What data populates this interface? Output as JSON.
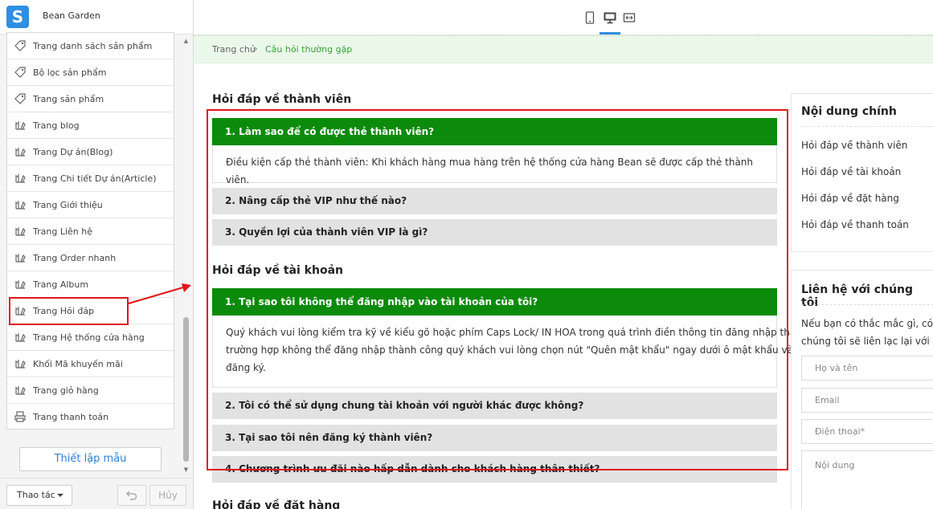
{
  "store": {
    "logo_letter": "S",
    "name": "Bean Garden"
  },
  "sidebar": {
    "items": [
      {
        "label": "Trang danh sách sản phẩm",
        "icon": "tag-icon"
      },
      {
        "label": "Bộ lọc sản phẩm",
        "icon": "tag-icon"
      },
      {
        "label": "Trang sản phẩm",
        "icon": "tag-icon"
      },
      {
        "label": "Trang blog",
        "icon": "blog-icon"
      },
      {
        "label": "Trang Dự án(Blog)",
        "icon": "blog-icon"
      },
      {
        "label": "Trang Chi tiết Dự án(Article)",
        "icon": "blog-icon"
      },
      {
        "label": "Trang Giới thiệu",
        "icon": "blog-icon"
      },
      {
        "label": "Trang Liên hệ",
        "icon": "blog-icon"
      },
      {
        "label": "Trang Order nhanh",
        "icon": "blog-icon"
      },
      {
        "label": "Trang Album",
        "icon": "blog-icon"
      },
      {
        "label": "Trang Hỏi đáp",
        "icon": "blog-icon"
      },
      {
        "label": "Trang Hệ thống cửa hàng",
        "icon": "blog-icon"
      },
      {
        "label": "Khối Mã khuyến mãi",
        "icon": "blog-icon"
      },
      {
        "label": "Trang giỏ hàng",
        "icon": "blog-icon"
      },
      {
        "label": "Trang thanh toán",
        "icon": "printer-icon"
      }
    ],
    "setup_button": "Thiết lập mẫu",
    "action_button": "Thao tác",
    "cancel_button": "Hủy"
  },
  "preview": {
    "breadcrumb": {
      "home": "Trang chủ",
      "separator": "›",
      "current": "Câu hỏi thường gặp"
    },
    "sections": {
      "member": {
        "title": "Hỏi đáp về thành viên",
        "q1": "1. Làm sao để có được thẻ thành viên?",
        "a1": "Điều kiện cấp thẻ thành viên: Khi khách hàng mua hàng trên hệ thống cửa hàng Bean sẽ được cấp thẻ thành viên.",
        "q2": "2. Nâng cấp thẻ VIP như thế nào?",
        "q3": "3. Quyền lợi của thành viên VIP là gì?"
      },
      "account": {
        "title": "Hỏi đáp về tài khoản",
        "q1": "1. Tại sao tôi không thể đăng nhập vào tài khoản của tôi?",
        "a1_line1": "Quý khách vui lòng kiểm tra kỹ về kiểu gõ hoặc phím Caps Lock/ IN HOA trong quá trình điền thông tin đăng nhập thành viên,",
        "a1_line2": "trường hợp không thể đăng nhập thành công quý khách vui lòng chọn nút \"Quên mật khẩu\" ngay dưới ô mật khẩu và nhập email đã",
        "a1_line3": "đăng ký.",
        "q2": "2. Tôi có thể sử dụng chung tài khoản với người khác được không?",
        "q3": "3. Tại sao tôi nên đăng ký thành viên?",
        "q4": "4. Chương trình ưu đãi nào hấp dẫn dành cho khách hàng thân thiết?"
      },
      "order": {
        "title": "Hỏi đáp về đặt hàng"
      }
    },
    "side": {
      "main_title": "Nội dung chính",
      "links": [
        "Hỏi đáp về thành viên",
        "Hỏi đáp về tài khoản",
        "Hỏi đáp về đặt hàng",
        "Hỏi đáp về thanh toán"
      ],
      "contact_title": "Liên hệ với chúng tôi",
      "contact_line1": "Nếu bạn có thắc mắc gì, có thể g",
      "contact_line2": "chúng tôi sẽ liên lạc lại với bạn sc",
      "fields": {
        "name": "Họ và tên",
        "email": "Email",
        "phone": "Điện thoại*",
        "content": "Nội dung"
      }
    }
  },
  "colors": {
    "accent": "#2f8fe0",
    "question_green": "#0b8a0b",
    "annotation_red": "#e0151d",
    "breadcrumb_bg": "#eaf8ea"
  }
}
